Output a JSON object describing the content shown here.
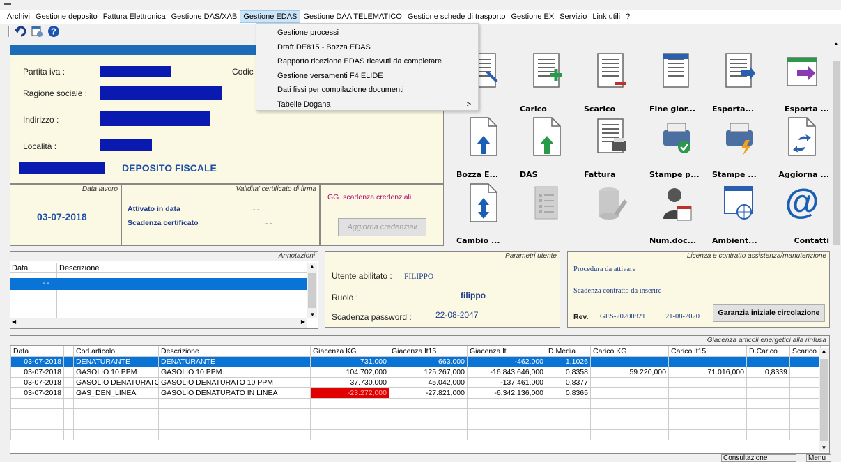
{
  "menu": [
    "Archivi",
    "Gestione deposito",
    "Fattura Elettronica",
    "Gestione DAS/XAB",
    "Gestione EDAS",
    "Gestione DAA TELEMATICO",
    "Gestione schede di trasporto",
    "Gestione EX",
    "Servizio",
    "Link utili",
    "?"
  ],
  "menu_active": "Gestione EDAS",
  "dropdown": [
    "Gestione processi",
    "Draft DE815 - Bozza EDAS",
    "Rapporto ricezione  EDAS ricevuti da completare",
    "Gestione versamenti F4 ELIDE",
    "Dati fissi per compilazione documenti",
    "Tabelle Dogana"
  ],
  "dropdown_arrow": ">",
  "company": {
    "partita_iva_label": "Partita iva :",
    "codice_label": "Codic",
    "ragione_label": "Ragione sociale :",
    "indirizzo_label": "Indirizzo :",
    "localita_label": "Località :",
    "deposito": "DEPOSITO FISCALE"
  },
  "dates": {
    "data_lavoro_title": "Data lavoro",
    "validita_title": "Validita' certificato di firma",
    "data_lavoro": "03-07-2018",
    "attivato_label": "Attivato in data",
    "attivato_value": "- -",
    "scadenza_label": "Scadenza certificato",
    "scadenza_value": "- -",
    "gg_label": "GG. scadenza credenziali",
    "aggiorna_btn": "Aggiorna credenziali"
  },
  "icons_row1": [
    "io ...",
    "Carico",
    "Scarico",
    "Fine gior...",
    "Esporta...",
    "Esporta ..."
  ],
  "icons_row2": [
    "Bozza E...",
    "DAS",
    "Fattura",
    "Stampe p...",
    "Stampe ...",
    "Aggiorna ..."
  ],
  "icons_row3": [
    "Cambio ...",
    "",
    "",
    "Num.doc...",
    "Ambient...",
    "Contatti"
  ],
  "annotazioni": {
    "title": "Annotazioni",
    "col_data": "Data",
    "col_desc": "Descrizione",
    "row_data": "- -"
  },
  "parametri": {
    "title": "Parametri utente",
    "utente_label": "Utente abilitato :",
    "utente_value": "FILIPPO",
    "ruolo_label": "Ruolo :",
    "ruolo_value": "filippo",
    "scad_label": "Scadenza password :",
    "scad_value": "22-08-2047"
  },
  "licenza": {
    "title": "Licenza e contratto assistenza/manutenzione",
    "procedura": "Procedura da attivare",
    "scadenza": "Scadenza contratto da inserire",
    "rev_label": "Rev.",
    "rev_value": "GES-20200821",
    "rev_date": "21-08-2020",
    "button": "Garanzia iniziale circolazione"
  },
  "giacenza": {
    "title": "Giacenza articoli energetici alla rinfusa",
    "columns": [
      "Data",
      "",
      "Cod.articolo",
      "Descrizione",
      "Giacenza KG",
      "Giacenza lt15",
      "Giacenza lt",
      "D.Media",
      "Carico KG",
      "Carico lt15",
      "D.Carico",
      "Scarico"
    ],
    "rows": [
      [
        "03-07-2018",
        "",
        "DENATURANTE",
        "DENATURANTE",
        "731,000",
        "663,000",
        "-462,000",
        "1,1026",
        "",
        "",
        "",
        ""
      ],
      [
        "03-07-2018",
        "",
        "GASOLIO 10 PPM",
        "GASOLIO 10 PPM",
        "104.702,000",
        "125.267,000",
        "-16.843.646,000",
        "0,8358",
        "59.220,000",
        "71.016,000",
        "0,8339",
        ""
      ],
      [
        "03-07-2018",
        "",
        "GASOLIO DENATURATO",
        "GASOLIO DENATURATO 10 PPM",
        "37.730,000",
        "45.042,000",
        "-137.461,000",
        "0,8377",
        "",
        "",
        "",
        ""
      ],
      [
        "03-07-2018",
        "",
        "GAS_DEN_LINEA",
        "GASOLIO DENATURATO IN LINEA",
        "-23.272,000",
        "-27.821,000",
        "-6.342.136,000",
        "0,8365",
        "",
        "",
        "",
        ""
      ]
    ]
  },
  "status": {
    "consultazione": "Consultazione",
    "menu": "Menu"
  }
}
